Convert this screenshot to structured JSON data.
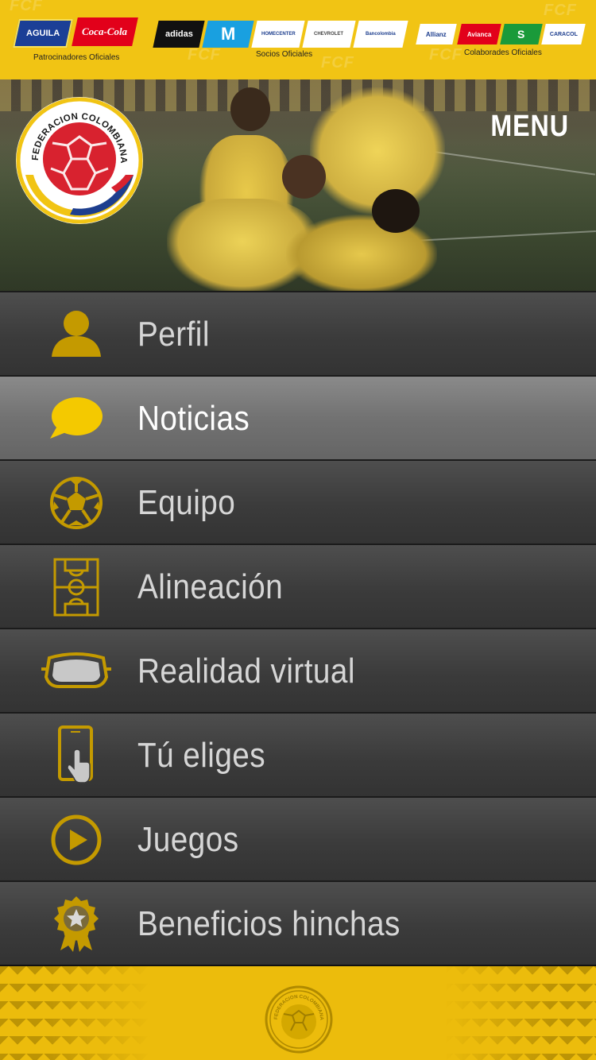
{
  "sponsors": {
    "watermark": "FCF",
    "groups": [
      {
        "caption": "Patrocinadores Oficiales",
        "logos": [
          "AGUILA",
          "Coca-Cola"
        ]
      },
      {
        "caption": "Socios Oficiales",
        "logos": [
          "adidas",
          "M",
          "HOMECENTER",
          "CHEVROLET",
          "Bancolombia"
        ]
      },
      {
        "caption": "Colaborades Oficiales",
        "logos": [
          "Allianz",
          "Avianca",
          "S",
          "CARACOL"
        ]
      }
    ]
  },
  "header": {
    "menu_label": "MENU",
    "crest_text": "FEDERACION COLOMBIANA DE FUTBOL"
  },
  "menu": {
    "items": [
      {
        "label": "Perfil",
        "icon": "user-icon",
        "active": false
      },
      {
        "label": "Noticias",
        "icon": "chat-bubble-icon",
        "active": true
      },
      {
        "label": "Equipo",
        "icon": "soccer-ball-icon",
        "active": false
      },
      {
        "label": "Alineación",
        "icon": "soccer-field-icon",
        "active": false
      },
      {
        "label": "Realidad virtual",
        "icon": "vr-headset-icon",
        "active": false
      },
      {
        "label": "Tú eliges",
        "icon": "touch-phone-icon",
        "active": false
      },
      {
        "label": "Juegos",
        "icon": "play-circle-icon",
        "active": false
      },
      {
        "label": "Beneficios hinchas",
        "icon": "award-badge-icon",
        "active": false
      }
    ]
  },
  "colors": {
    "brand_yellow": "#f1c414",
    "icon_gold": "#c49a00",
    "icon_bright": "#f4c900",
    "crest_red": "#d8222f",
    "crest_blue": "#1d3e8e"
  }
}
